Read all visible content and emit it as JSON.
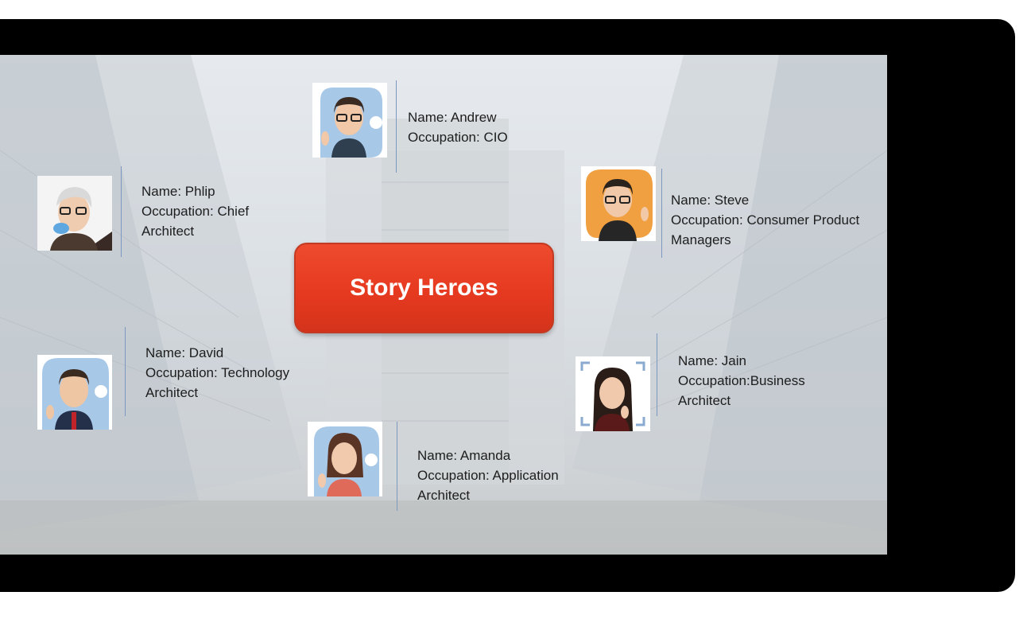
{
  "slide": {
    "title": "Story Heroes",
    "title_color": "#e8412a",
    "heroes": [
      {
        "name_line": "Name: Andrew",
        "occupation_lines": [
          "Occupation: CIO"
        ],
        "avatar_bg": "#a8c8e8"
      },
      {
        "name_line": "Name: Phlip",
        "occupation_lines": [
          "Occupation: Chief",
          "Architect"
        ],
        "avatar_bg": "#ffffff"
      },
      {
        "name_line": "Name: Steve",
        "occupation_lines": [
          "Occupation: Consumer Product",
          "Managers"
        ],
        "avatar_bg": "#f0a040"
      },
      {
        "name_line": "Name: David",
        "occupation_lines": [
          "Occupation: Technology",
          " Architect"
        ],
        "avatar_bg": "#a8c8e8"
      },
      {
        "name_line": "Name: Jain",
        "occupation_lines": [
          "Occupation:Business",
          " Architect"
        ],
        "avatar_bg": "#ffffff"
      },
      {
        "name_line": "Name: Amanda",
        "occupation_lines": [
          "Occupation: Application",
          "Architect"
        ],
        "avatar_bg": "#a8c8e8"
      }
    ]
  }
}
